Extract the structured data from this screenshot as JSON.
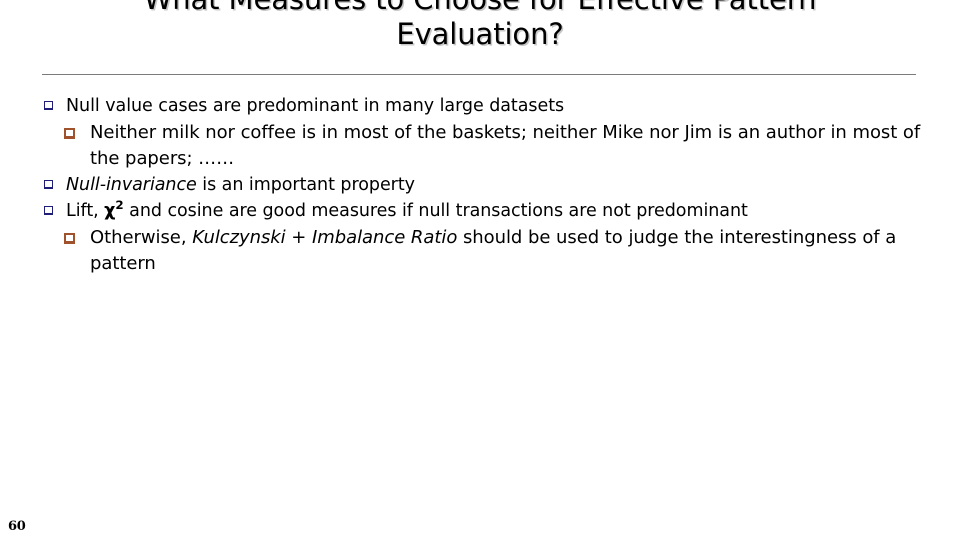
{
  "slide": {
    "title": "What Measures to Choose for Effective Pattern\nEvaluation?",
    "page_number": "60",
    "divider_color": "#7a7a7a",
    "title_shadow_color": "#c8c8c8"
  },
  "bullets": {
    "level1_marker_color": "#1f1f7a",
    "level2_marker_color": "#a0522d",
    "items": [
      {
        "level": 1,
        "text": "Null value cases are predominant in many large datasets"
      },
      {
        "level": 2,
        "text": "Neither milk nor coffee is in most of the baskets; neither Mike nor Jim is an author in most of the papers; ……"
      },
      {
        "level": 1,
        "emphasis": "Null-invariance",
        "text_after": " is an important property"
      },
      {
        "level": 1,
        "text_before": "Lift, ",
        "symbol": "χ",
        "symbol_exponent": "2",
        "text_after": " and cosine are good measures if null transactions are not predominant"
      },
      {
        "level": 2,
        "text_before": "Otherwise, ",
        "emphasis": "Kulczynski + Imbalance Ratio",
        "text_after": " should be used to judge the interestingness of a pattern"
      }
    ]
  }
}
